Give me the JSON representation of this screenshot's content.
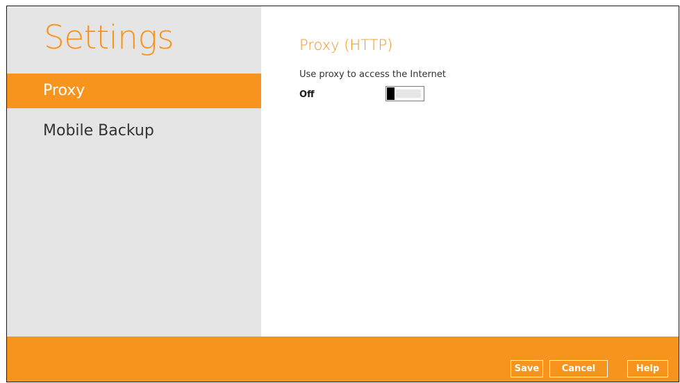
{
  "sidebar": {
    "title": "Settings",
    "items": [
      {
        "label": "Proxy",
        "active": true
      },
      {
        "label": "Mobile Backup",
        "active": false
      }
    ]
  },
  "main": {
    "section_title": "Proxy (HTTP)",
    "proxy_description": "Use proxy to access the Internet",
    "proxy_toggle": {
      "state_label": "Off",
      "enabled": false
    }
  },
  "footer": {
    "save_label": "Save",
    "cancel_label": "Cancel",
    "help_label": "Help"
  },
  "colors": {
    "accent": "#f7941e",
    "sidebar_bg": "#e5e5e5",
    "text": "#333333"
  }
}
